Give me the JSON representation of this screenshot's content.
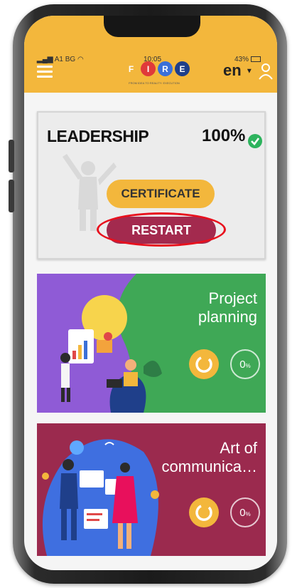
{
  "status_bar": {
    "carrier": "A1 BG",
    "time": "10:05",
    "battery": "43%"
  },
  "header": {
    "logo_letters": [
      "F",
      "I",
      "R",
      "E"
    ],
    "logo_colors": [
      "#f3b73c",
      "#e03a3a",
      "#3a6fd8",
      "#1f3f8a"
    ],
    "tagline": "FROM IDEA TO REALITY: EXECUTION",
    "language": "en",
    "menu_icon": "hamburger-icon",
    "user_icon": "user-icon"
  },
  "courses": [
    {
      "title": "LEADERSHIP",
      "progress": "100%",
      "completed": true,
      "certificate_label": "CERTIFICATE",
      "restart_label": "RESTART"
    },
    {
      "title_line1": "Project",
      "title_line2": "planning",
      "progress_value": "0",
      "progress_unit": "%"
    },
    {
      "title_line1": "Art of",
      "title_line2": "communica…",
      "progress_value": "0",
      "progress_unit": "%"
    }
  ],
  "colors": {
    "accent": "#f3b73c",
    "restart": "#a32a4e",
    "project_card": "#3fa856",
    "communication_card": "#9b2a4e",
    "highlight_ring": "#e8101d",
    "check": "#2db35d"
  }
}
